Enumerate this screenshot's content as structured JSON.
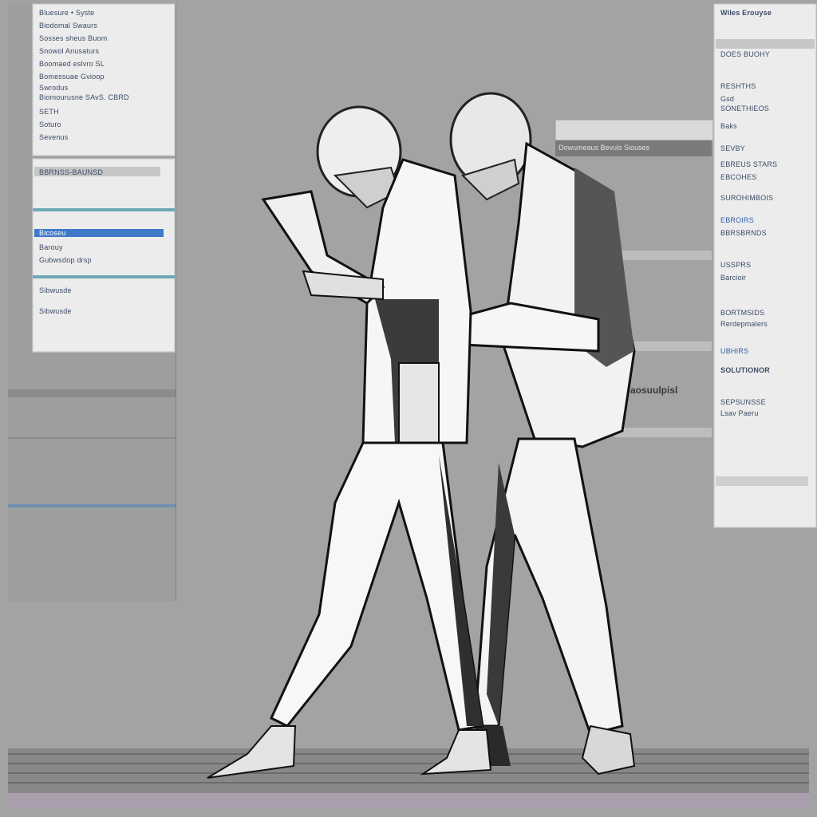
{
  "left_panel_top": {
    "rows": [
      "Bluesure  •  Syste",
      "Biodomal  Swaurs",
      "Sosses sheus   Buom",
      "Snowol  Anusaturs",
      "Boomaed  eslvro  SL",
      "Bomessuae  Gvioop",
      "Swrodus",
      "Biomourusne SAvS. CBRD",
      "SETH",
      "Soturo",
      "Sevenus"
    ]
  },
  "left_panel_mid": {
    "rows": [
      "BBRNSS-BAUNSD",
      "Barouy",
      "Gubwsdop  drsp",
      "Sibwusde"
    ],
    "selected": "Bicoseu"
  },
  "right_panel": {
    "title": "Wiles  Erouyse",
    "subtitle": "DOES  BUOHY",
    "rows": [
      "RESHTHS",
      "Gsd",
      "SONETHIEOS",
      "Baks",
      "SEVBY",
      "EBREUS  STARS",
      "EBCOHES",
      "SUROHIMBOIS",
      "EBROIRS",
      "BBRSBRNDS",
      "USSPRS",
      "Barcioir",
      "BORTMSIDS",
      "Rerdepmalers",
      "UBHIRS",
      "SOLUTIONOR",
      "SEPSUNSSE",
      "Lsav Paeru"
    ]
  },
  "window_strip": {
    "label": "Dowumeaus Bevuls Siouses"
  },
  "hover_label": "aosuulpisl",
  "colors": {
    "background": "#a3a3a3",
    "panel": "#ececec",
    "accent_blue": "#3f79c8",
    "accent_teal": "#6fa8b8"
  }
}
